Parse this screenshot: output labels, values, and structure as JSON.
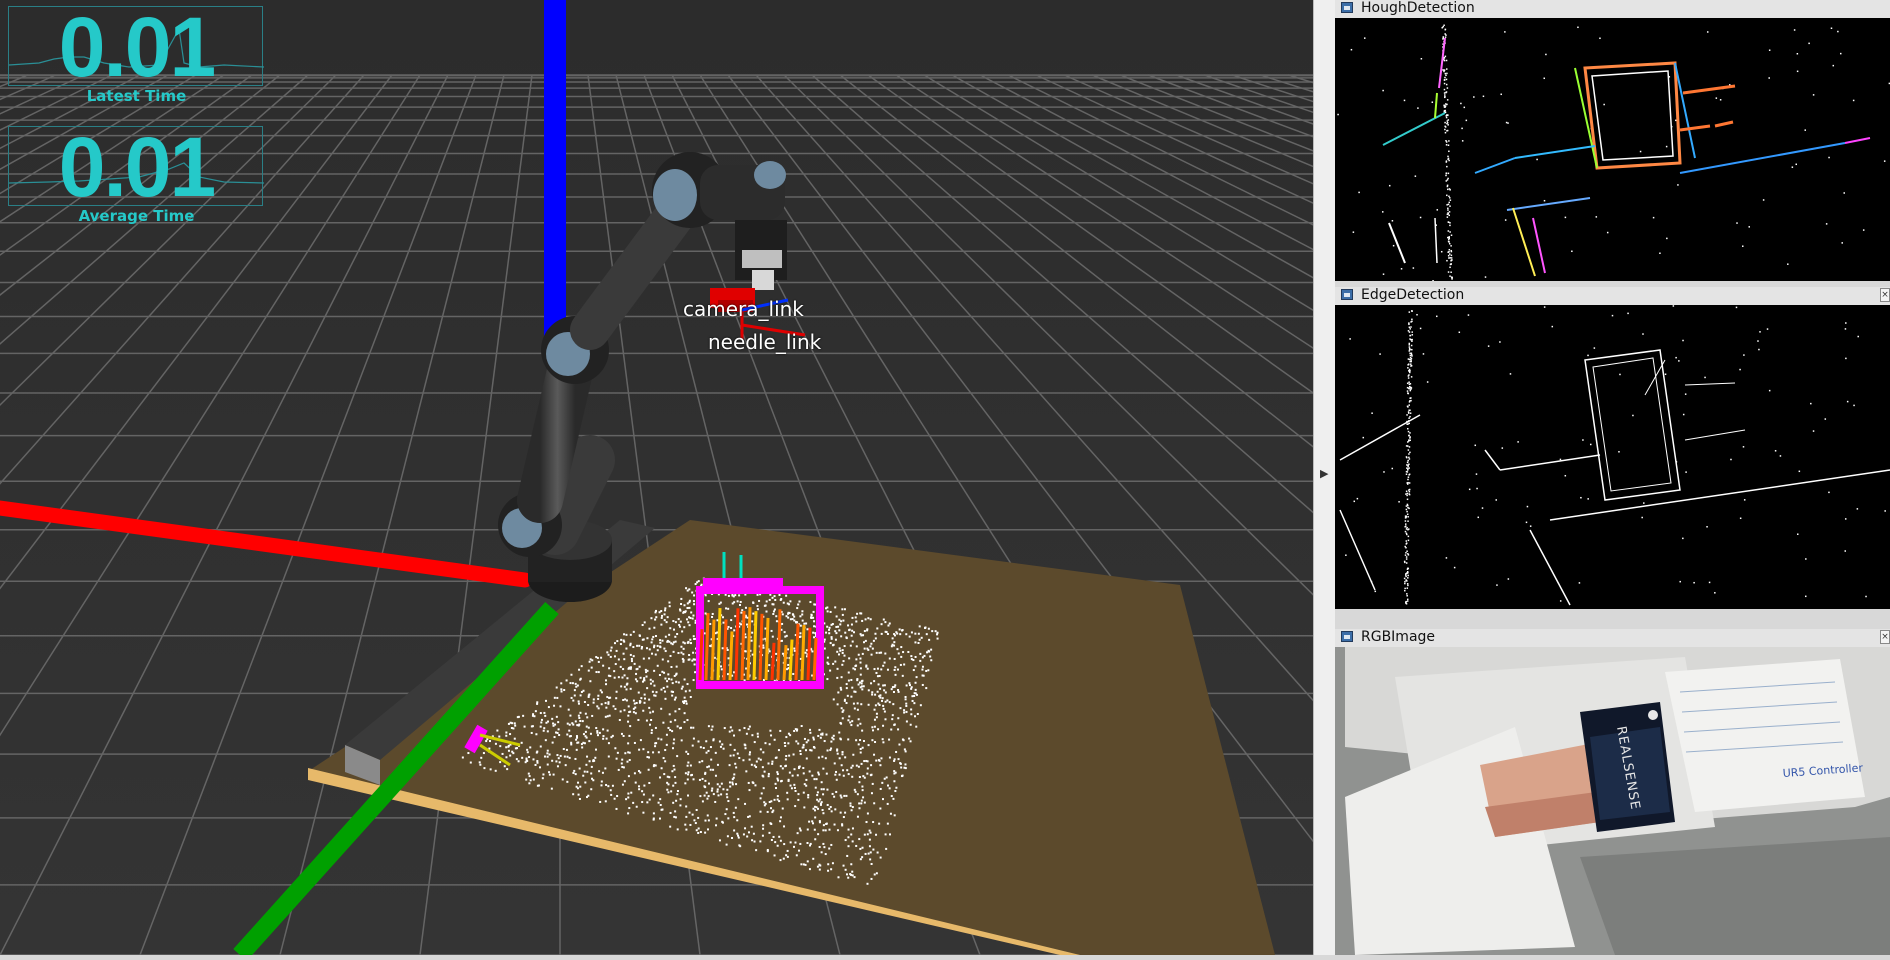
{
  "viewport": {
    "frame_labels": {
      "camera_link": "camera_link",
      "needle_link": "needle_link"
    },
    "colors": {
      "background": "#303030",
      "grid": "#6e6e6e",
      "x_axis": "#ff0000",
      "y_axis": "#00aa00",
      "z_axis": "#0000ff",
      "table": "#5c4a2c",
      "table_edge": "#e7b96a",
      "point_cloud": "#ffffff",
      "overlay_text": "#25c9c9"
    }
  },
  "stats": [
    {
      "value": "0.01",
      "label": "Latest Time"
    },
    {
      "value": "0.01",
      "label": "Average Time"
    }
  ],
  "panels": [
    {
      "title": "HoughDetection",
      "icon": "window-icon"
    },
    {
      "title": "EdgeDetection",
      "icon": "window-icon"
    },
    {
      "title": "RGBImage",
      "icon": "window-icon"
    }
  ],
  "rgb_image": {
    "box_text": "REALSENSE",
    "box_brand": "intel",
    "note_text": "UR5 Controller"
  }
}
